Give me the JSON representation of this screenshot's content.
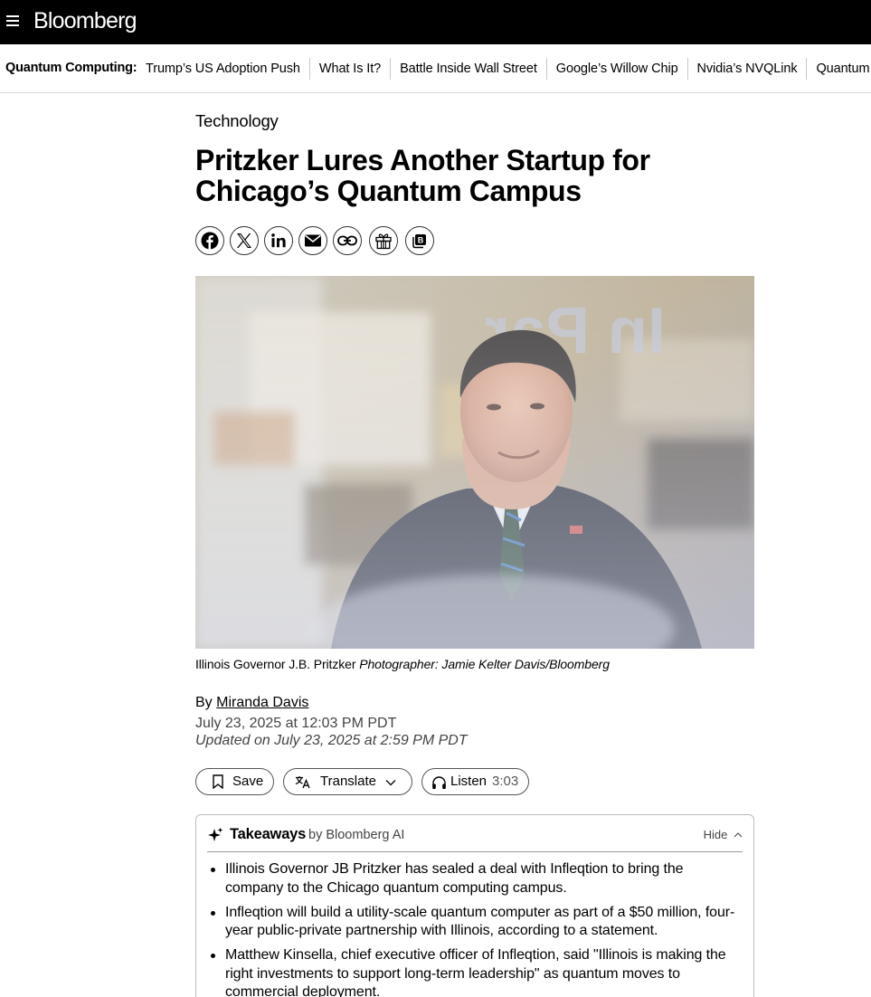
{
  "app": {
    "logo": "Bloomberg"
  },
  "topbar": {
    "menu_icon": "hamburger-menu-icon"
  },
  "subnav": {
    "label": "Quantum Computing:",
    "links": [
      "Trump’s US Adoption Push",
      "What Is It?",
      "Battle Inside Wall Street",
      "Google’s Willow Chip",
      "Nvidia’s NVQLink",
      "Quantum"
    ]
  },
  "article": {
    "kicker": "Technology",
    "headline": "Pritzker Lures Another Startup for Chicago’s Quantum Campus",
    "share_icons": [
      "facebook-icon",
      "x-icon",
      "linkedin-icon",
      "email-icon",
      "link-icon",
      "gift-icon",
      "bloomberg-terminal-icon"
    ],
    "caption": {
      "text": "Illinois Governor J.B. Pritzker",
      "credit": "Photographer: Jamie Kelter Davis/Bloomberg"
    },
    "byline": {
      "prefix": "By",
      "author": "Miranda Davis"
    },
    "published": "July 23, 2025 at 12:03 PM PDT",
    "updated": "Updated on July 23, 2025 at 2:59 PM PDT"
  },
  "actions": {
    "save": "Save",
    "translate": "Translate",
    "listen": "Listen",
    "listen_duration": "3:03"
  },
  "takeaways": {
    "title": "Takeaways",
    "by": "by Bloomberg AI",
    "hide": "Hide",
    "items": [
      "Illinois Governor JB Pritzker has sealed a deal with Infleqtion to bring the company to the Chicago quantum computing campus.",
      "Infleqtion will build a utility-scale quantum computer as part of a $50 million, four-year public-private partnership with Illinois, according to a statement.",
      "Matthew Kinsella, chief executive officer of Infleqtion, said \"Illinois is making the right investments to support long-term leadership\" as quantum moves to commercial deployment."
    ]
  },
  "colors": {
    "background": "#ffffff",
    "topbar": "#000000",
    "text": "#000000",
    "muted": "#444444"
  }
}
